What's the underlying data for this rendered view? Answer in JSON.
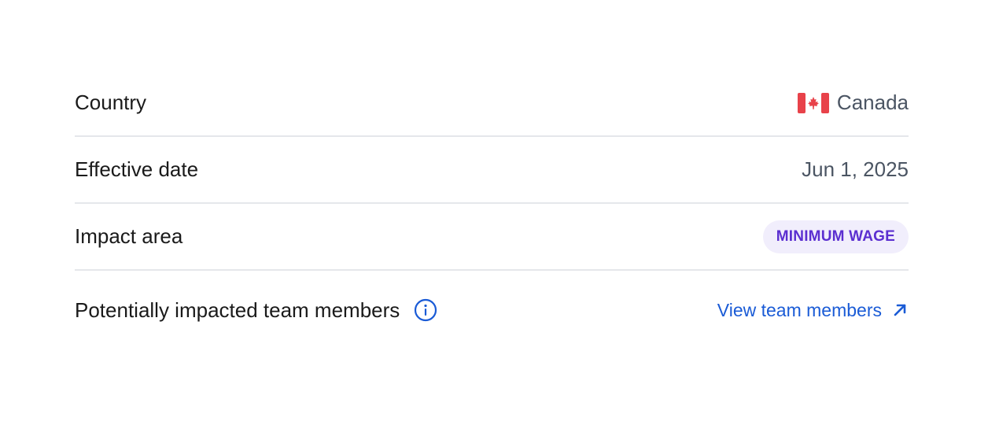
{
  "rows": {
    "country": {
      "label": "Country",
      "value": "Canada",
      "flag_icon": "canada-flag-icon"
    },
    "effective_date": {
      "label": "Effective date",
      "value": "Jun 1, 2025"
    },
    "impact_area": {
      "label": "Impact area",
      "badge": "MINIMUM WAGE"
    },
    "team_members": {
      "label": "Potentially impacted team members",
      "info_icon": "info-icon",
      "link_text": "View team members",
      "link_icon": "arrow-up-right-icon"
    }
  },
  "colors": {
    "label_text": "#1a1a1a",
    "value_text": "#4b5563",
    "divider": "#e5e7eb",
    "badge_bg": "#f1eefc",
    "badge_text": "#5b2fd0",
    "link": "#1a5bd6",
    "flag_red": "#e8424a"
  }
}
